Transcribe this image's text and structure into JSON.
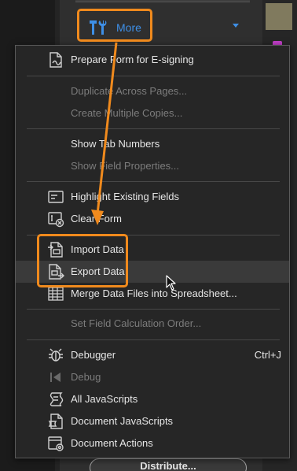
{
  "more_button": {
    "label": "More",
    "icon": "tools-icon"
  },
  "menu": {
    "prepare_form": {
      "label": "Prepare Form for E-signing",
      "icon": "e-sign-icon"
    },
    "duplicate_pages": {
      "label": "Duplicate Across Pages...",
      "disabled": true
    },
    "create_copies": {
      "label": "Create Multiple Copies...",
      "disabled": true
    },
    "show_tab_numbers": {
      "label": "Show Tab Numbers"
    },
    "show_field_properties": {
      "label": "Show Field Properties...",
      "disabled": true
    },
    "highlight_fields": {
      "label": "Highlight Existing Fields",
      "icon": "highlight-fields-icon"
    },
    "clear_form": {
      "label": "Clear Form",
      "icon": "clear-form-icon"
    },
    "import_data": {
      "label": "Import Data",
      "icon": "import-data-icon"
    },
    "export_data": {
      "label": "Export Data",
      "icon": "export-data-icon"
    },
    "merge_data": {
      "label": "Merge Data Files into Spreadsheet...",
      "icon": "spreadsheet-icon"
    },
    "set_field_calc": {
      "label": "Set Field Calculation Order...",
      "disabled": true
    },
    "debugger": {
      "label": "Debugger",
      "shortcut": "Ctrl+J",
      "icon": "bug-icon"
    },
    "debug": {
      "label": "Debug",
      "disabled": true,
      "icon": "debug-icon"
    },
    "all_js": {
      "label": "All JavaScripts",
      "icon": "script-icon"
    },
    "doc_js": {
      "label": "Document JavaScripts",
      "icon": "doc-script-icon"
    },
    "doc_actions": {
      "label": "Document Actions",
      "icon": "doc-actions-icon"
    }
  },
  "background": {
    "distribute_label": "Distribute..."
  },
  "colors": {
    "highlight": "#f08a1d",
    "accent": "#3e8fe6"
  }
}
